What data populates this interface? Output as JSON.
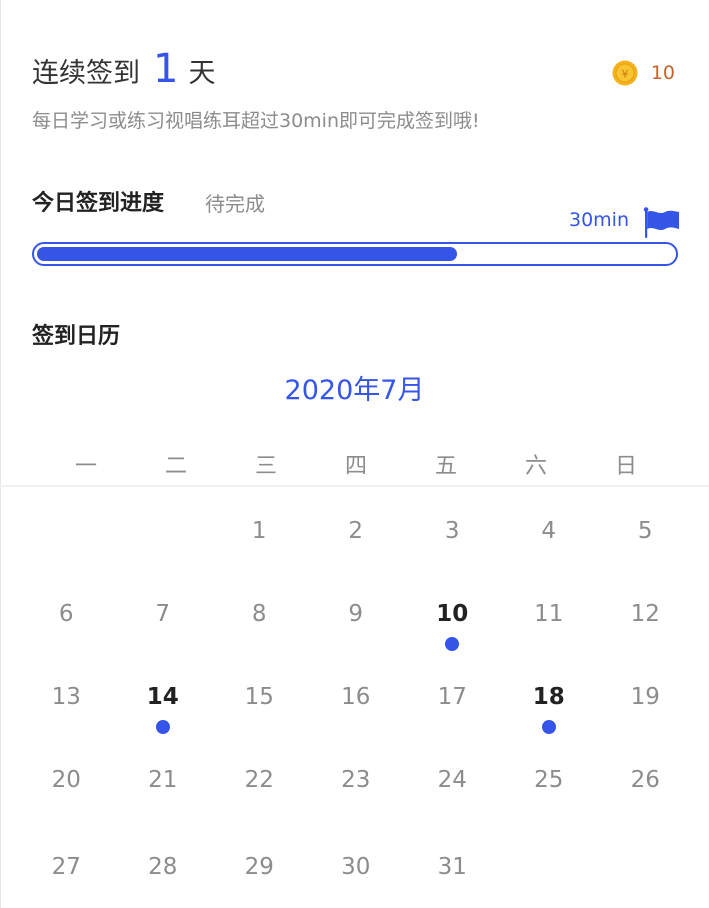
{
  "header": {
    "streak_prefix": "连续签到",
    "streak_count": "1",
    "streak_suffix": "天",
    "coin_icon": "coin-icon",
    "coin_count": "10",
    "hint": "每日学习或练习视唱练耳超过30min即可完成签到哦!"
  },
  "progress": {
    "title": "今日签到进度",
    "status": "待完成",
    "target_label": "30min",
    "flag_icon": "flag-icon",
    "fraction": 0.66
  },
  "calendar": {
    "title": "签到日历",
    "month_label": "2020年7月",
    "weekdays": [
      "一",
      "二",
      "三",
      "四",
      "五",
      "六",
      "日"
    ],
    "leading_blanks": 2,
    "days": [
      {
        "day": "1",
        "checked": false
      },
      {
        "day": "2",
        "checked": false
      },
      {
        "day": "3",
        "checked": false
      },
      {
        "day": "4",
        "checked": false
      },
      {
        "day": "5",
        "checked": false
      },
      {
        "day": "6",
        "checked": false
      },
      {
        "day": "7",
        "checked": false
      },
      {
        "day": "8",
        "checked": false
      },
      {
        "day": "9",
        "checked": false
      },
      {
        "day": "10",
        "checked": true
      },
      {
        "day": "11",
        "checked": false
      },
      {
        "day": "12",
        "checked": false
      },
      {
        "day": "13",
        "checked": false
      },
      {
        "day": "14",
        "checked": true
      },
      {
        "day": "15",
        "checked": false
      },
      {
        "day": "16",
        "checked": false
      },
      {
        "day": "17",
        "checked": false
      },
      {
        "day": "18",
        "checked": true
      },
      {
        "day": "19",
        "checked": false
      },
      {
        "day": "20",
        "checked": false
      },
      {
        "day": "21",
        "checked": false
      },
      {
        "day": "22",
        "checked": false
      },
      {
        "day": "23",
        "checked": false
      },
      {
        "day": "24",
        "checked": false
      },
      {
        "day": "25",
        "checked": false
      },
      {
        "day": "26",
        "checked": false
      },
      {
        "day": "27",
        "checked": false
      },
      {
        "day": "28",
        "checked": false
      },
      {
        "day": "29",
        "checked": false
      },
      {
        "day": "30",
        "checked": false
      },
      {
        "day": "31",
        "checked": false
      }
    ]
  },
  "colors": {
    "accent": "#3554e8",
    "coin": "#f5b21b",
    "coin_text": "#c9612a",
    "muted_text": "#8c8c8c"
  }
}
